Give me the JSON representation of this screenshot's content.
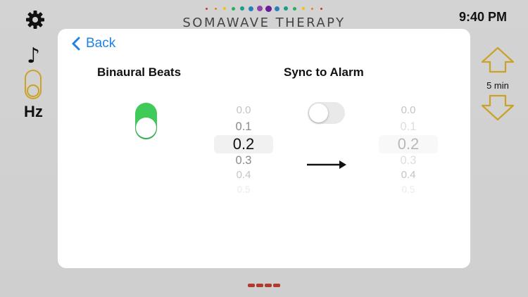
{
  "app": {
    "title": "SOMAWAVE THERAPY",
    "time": "9:40 PM"
  },
  "top_dots_colors": [
    "#c0392b",
    "#e67e22",
    "#f1c40f",
    "#27ae60",
    "#16a085",
    "#2980b9",
    "#8e44ad",
    "#6a1b9a",
    "#2980b9",
    "#16a085",
    "#27ae60",
    "#f1c40f",
    "#e67e22",
    "#c0392b"
  ],
  "left_bar": {
    "settings_icon": "gear-icon",
    "note_symbol": "♪",
    "unit_label": "Hz"
  },
  "right_bar": {
    "duration_label": "5 min"
  },
  "panel": {
    "back_label": "Back",
    "binaural_title": "Binaural Beats",
    "sync_title": "Sync to Alarm",
    "binaural_enabled": true,
    "sync_enabled": false,
    "arrow_glyph": "long-right-arrow",
    "picker_left": {
      "items": [
        "0.0",
        "0.1",
        "0.2",
        "0.3",
        "0.4",
        "0.5"
      ],
      "selected": "0.2"
    },
    "picker_right": {
      "items": [
        "0.0",
        "0.1",
        "0.2",
        "0.3",
        "0.4",
        "0.5"
      ],
      "selected": "0.2"
    }
  },
  "colors": {
    "accent_green": "#3fca5a",
    "accent_gold": "#c9a227",
    "link_blue": "#1e82e8",
    "indicator_red": "#b23a2a"
  }
}
